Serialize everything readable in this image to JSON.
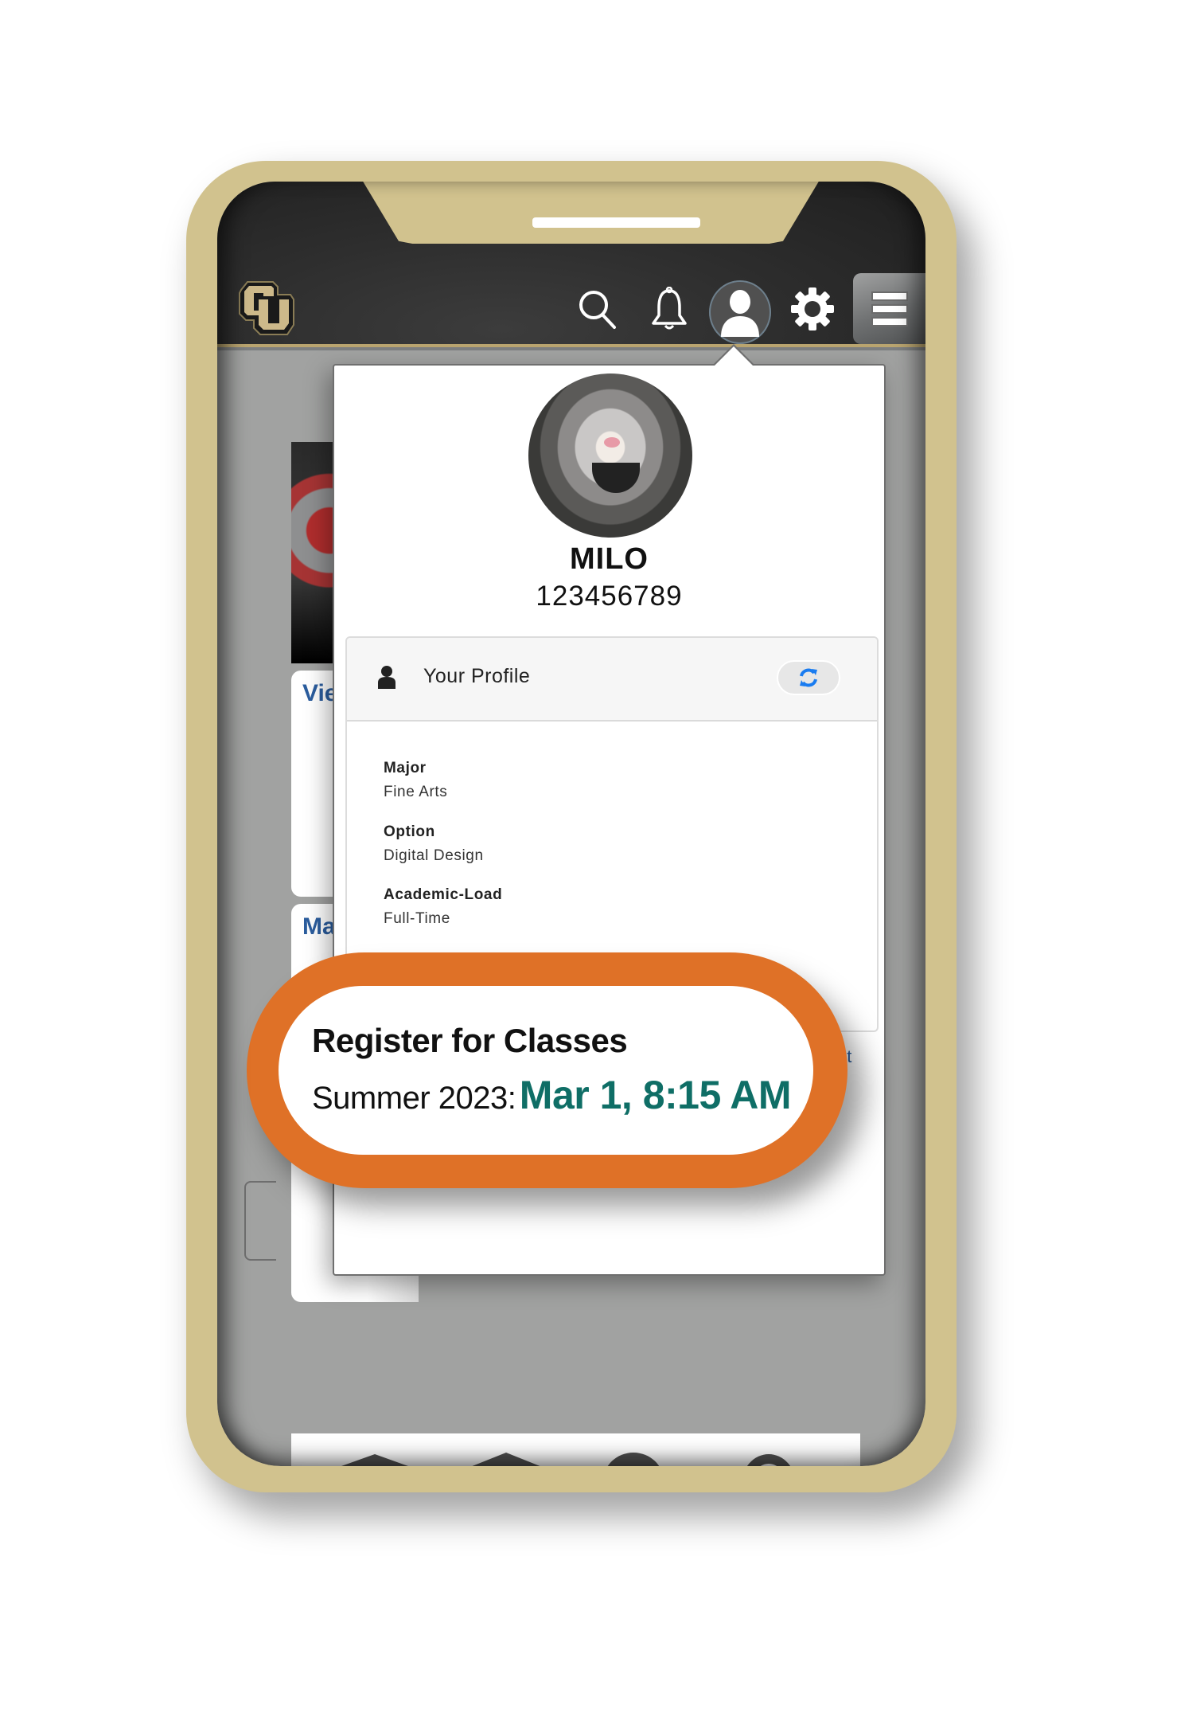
{
  "header": {
    "logo_alt": "CU",
    "icons": [
      "search-icon",
      "bell-icon",
      "user-icon",
      "gear-icon",
      "menu-icon"
    ]
  },
  "background": {
    "card_1_title": "Vie",
    "card_2_title": "Ma",
    "signout_fragment": "ut",
    "bottom_nav_icons": [
      "graduation-cap-icon",
      "bank-icon",
      "chat-icon",
      "search-icon"
    ]
  },
  "profile": {
    "name": "MILO",
    "id": "123456789",
    "section_label": "Your Profile",
    "fields": [
      {
        "label": "Major",
        "value": "Fine Arts"
      },
      {
        "label": "Option",
        "value": "Digital Design"
      },
      {
        "label": "Academic-Load",
        "value": "Full-Time"
      }
    ]
  },
  "callout": {
    "title": "Register for Classes",
    "term": "Summer 2023:",
    "date": "Mar 1, 8:15 AM"
  },
  "colors": {
    "frame_gold": "#d1c28e",
    "callout_orange": "#df7127",
    "date_teal": "#0f6e66",
    "link_blue": "#2b5d9e",
    "refresh_blue": "#1a7cf0"
  }
}
